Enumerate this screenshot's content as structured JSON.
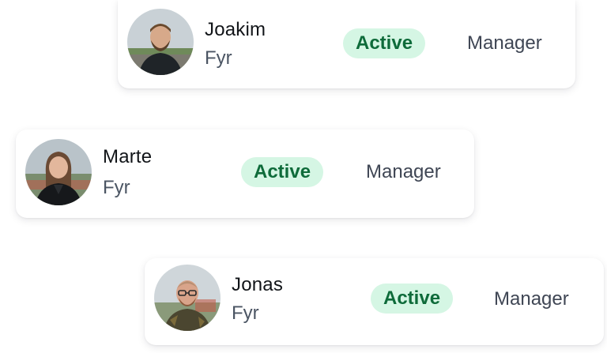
{
  "users": [
    {
      "name": "Joakim",
      "subtitle": "Fyr",
      "status": "Active",
      "role": "Manager",
      "avatar_icon": "person-avatar-icon"
    },
    {
      "name": "Marte",
      "subtitle": "Fyr",
      "status": "Active",
      "role": "Manager",
      "avatar_icon": "person-avatar-icon"
    },
    {
      "name": "Jonas",
      "subtitle": "Fyr",
      "status": "Active",
      "role": "Manager",
      "avatar_icon": "person-avatar-icon"
    }
  ],
  "colors": {
    "badge_bg": "#d5f6e4",
    "badge_text": "#0e6b3a",
    "role_text": "#3f4654",
    "name_text": "#111418"
  }
}
